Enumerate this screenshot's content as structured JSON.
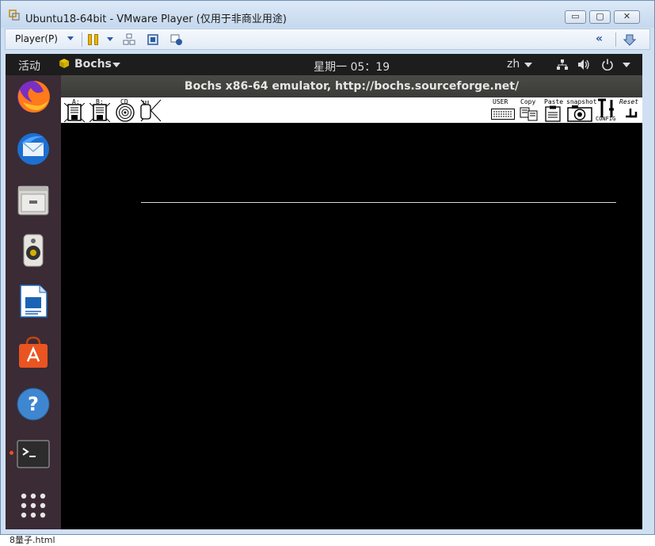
{
  "vmware": {
    "title": "Ubuntu18-64bit - VMware Player (仅用于非商业用途)",
    "player_menu": "Player(P)",
    "window_buttons": {
      "minimize": "▭",
      "maximize": "▢",
      "close": "✕"
    }
  },
  "ubuntu": {
    "activities": "活动",
    "app_name": "Bochs",
    "clock": "星期一 05：19",
    "language": "zh",
    "dock": [
      {
        "name": "firefox"
      },
      {
        "name": "thunderbird"
      },
      {
        "name": "files"
      },
      {
        "name": "rhythmbox"
      },
      {
        "name": "libreoffice-writer"
      },
      {
        "name": "ubuntu-software"
      },
      {
        "name": "help"
      },
      {
        "name": "terminal",
        "active": true
      },
      {
        "name": "show-applications"
      }
    ]
  },
  "bochs": {
    "title": "Bochs x86-64 emulator, http://bochs.sourceforge.net/",
    "toolbar": {
      "floppy_a": "A:",
      "floppy_b": "B:",
      "cdrom": "CD",
      "user": "USER",
      "copy": "Copy",
      "paste": "Paste",
      "snapshot": "snapshot",
      "config": "CONFIG",
      "reset": "Reset"
    }
  },
  "footer": "8量子.html"
}
